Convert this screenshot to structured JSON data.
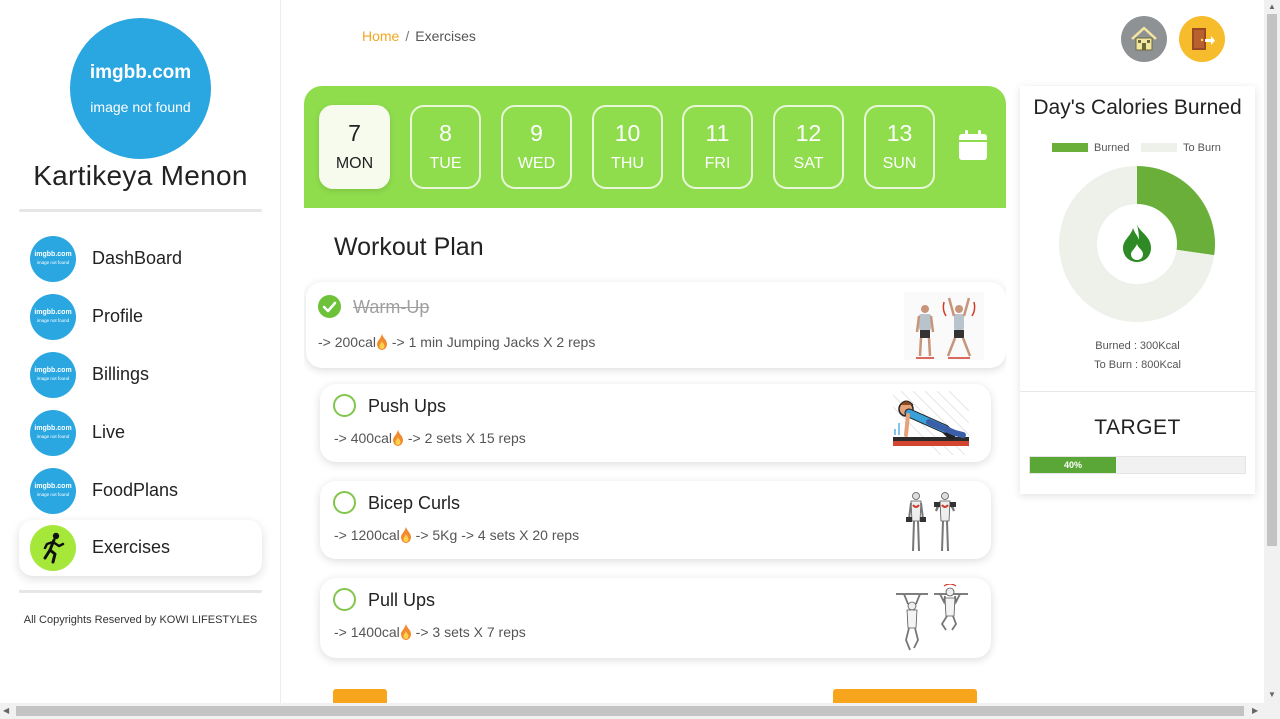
{
  "sidebar": {
    "avatar": {
      "line1": "imgbb.com",
      "line2": "image not found"
    },
    "user_name": "Kartikeya Menon",
    "nav_icon_text": {
      "line1": "imgbb.com",
      "line2": "image not found"
    },
    "items": [
      {
        "label": "DashBoard",
        "icon": "broken-image-icon"
      },
      {
        "label": "Profile",
        "icon": "broken-image-icon"
      },
      {
        "label": "Billings",
        "icon": "broken-image-icon"
      },
      {
        "label": "Live",
        "icon": "broken-image-icon"
      },
      {
        "label": "FoodPlans",
        "icon": "broken-image-icon"
      },
      {
        "label": "Exercises",
        "icon": "running-person-icon",
        "active": true
      }
    ],
    "copyright": "All Copyrights Reserved by KOWI LIFESTYLES"
  },
  "breadcrumb": {
    "home": "Home",
    "separator": "/",
    "current": "Exercises"
  },
  "header_buttons": [
    {
      "name": "home",
      "icon": "house-icon",
      "color": "#8f9295"
    },
    {
      "name": "logout",
      "icon": "exit-door-icon",
      "color": "#f6bc2c"
    }
  ],
  "week": {
    "days": [
      {
        "num": "7",
        "name": "MON",
        "active": true
      },
      {
        "num": "8",
        "name": "TUE"
      },
      {
        "num": "9",
        "name": "WED"
      },
      {
        "num": "10",
        "name": "THU"
      },
      {
        "num": "11",
        "name": "FRI"
      },
      {
        "num": "12",
        "name": "SAT"
      },
      {
        "num": "13",
        "name": "SUN"
      }
    ],
    "calendar_icon": "calendar-icon"
  },
  "workout": {
    "title": "Workout Plan",
    "exercises": [
      {
        "name": "Warm-Up",
        "done": true,
        "cal": "-> 200cal",
        "rest": " -> 1 min Jumping Jacks X 2 reps",
        "image": "jumping-jacks-illustration"
      },
      {
        "name": "Push Ups",
        "done": false,
        "cal": "-> 400cal",
        "rest": " -> 2 sets X 15 reps",
        "image": "push-up-illustration"
      },
      {
        "name": "Bicep Curls",
        "done": false,
        "cal": "-> 1200cal",
        "rest": " -> 5Kg -> 4 sets X 20 reps",
        "image": "bicep-curl-illustration"
      },
      {
        "name": "Pull Ups",
        "done": false,
        "cal": "-> 1400cal",
        "rest": " -> 3 sets X 7 reps",
        "image": "pull-up-illustration"
      }
    ]
  },
  "calories": {
    "title": "Day's Calories Burned",
    "legend": {
      "burned": "Burned",
      "to_burn": "To Burn"
    },
    "burned_text": "Burned : 300Kcal",
    "to_burn_text": "To Burn : 800Kcal",
    "burned_value": 300,
    "to_burn_value": 800,
    "colors": {
      "burned": "#6aaf3a",
      "to_burn": "#edf1e9",
      "flame": "#2d8a25"
    }
  },
  "target": {
    "title": "TARGET",
    "progress_label": "40%",
    "progress": 0.4
  },
  "colors": {
    "accent_green": "#8fdd4d",
    "orange": "#f4a521"
  }
}
